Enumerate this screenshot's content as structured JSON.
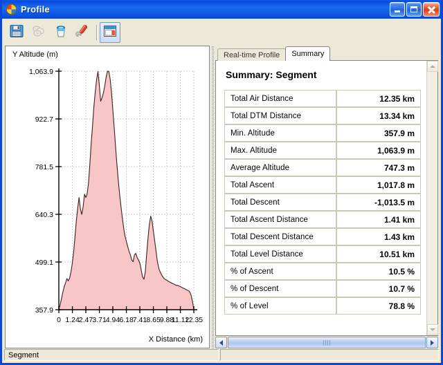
{
  "window": {
    "title": "Profile",
    "icon": "profile-globe-icon",
    "buttons": {
      "minimize": "Minimize",
      "maximize": "Maximize",
      "close": "Close"
    }
  },
  "toolbar": {
    "items": [
      {
        "name": "save-icon",
        "title": "Save",
        "enabled": true
      },
      {
        "name": "copy-icon",
        "title": "Copy",
        "enabled": false
      },
      {
        "name": "bucket-icon",
        "title": "Fill",
        "enabled": true
      },
      {
        "name": "settings-icon",
        "title": "Settings",
        "enabled": true
      },
      {
        "name": "layout-icon",
        "title": "Layout",
        "enabled": true,
        "selected": true
      }
    ]
  },
  "chart_data": {
    "type": "area",
    "title": "",
    "xlabel": "X Distance (km)",
    "ylabel": "Y Altitude (m)",
    "ylim": [
      357.9,
      1063.9
    ],
    "xlim": [
      0,
      12.35
    ],
    "grid": true,
    "legend": "none",
    "fill_color": "#f8c6c6",
    "line_color": "#3b2020",
    "yticks": [
      "1,063.9",
      "922.7",
      "781.5",
      "640.3",
      "499.1",
      "357.9"
    ],
    "ytick_values": [
      1063.9,
      922.7,
      781.5,
      640.3,
      499.1,
      357.9
    ],
    "xticks": [
      "0",
      "1.24",
      "2.47",
      "3.71",
      "4.94",
      "6.18",
      "7.41",
      "8.65",
      "9.88",
      "11.12",
      "12.35"
    ],
    "xtick_values": [
      0,
      1.24,
      2.47,
      3.71,
      4.94,
      6.18,
      7.41,
      8.65,
      9.88,
      11.12,
      12.35
    ],
    "x": [
      0.0,
      0.12,
      0.25,
      0.37,
      0.49,
      0.62,
      0.74,
      0.86,
      0.99,
      1.11,
      1.23,
      1.36,
      1.48,
      1.6,
      1.73,
      1.85,
      1.98,
      2.1,
      2.22,
      2.35,
      2.47,
      2.59,
      2.72,
      2.84,
      2.96,
      3.09,
      3.21,
      3.34,
      3.46,
      3.58,
      3.71,
      3.83,
      3.95,
      4.08,
      4.2,
      4.32,
      4.45,
      4.57,
      4.7,
      4.82,
      4.94,
      5.07,
      5.19,
      5.31,
      5.44,
      5.56,
      5.68,
      5.81,
      5.93,
      6.06,
      6.18,
      6.3,
      6.43,
      6.55,
      6.67,
      6.8,
      6.92,
      7.04,
      7.17,
      7.29,
      7.42,
      7.54,
      7.66,
      7.79,
      7.91,
      8.03,
      8.16,
      8.28,
      8.41,
      8.53,
      8.65,
      8.78,
      8.9,
      9.02,
      9.15,
      9.27,
      9.39,
      9.52,
      9.64,
      9.77,
      9.89,
      10.01,
      10.14,
      10.26,
      10.38,
      10.51,
      10.63,
      10.75,
      10.88,
      11.0,
      11.13,
      11.25,
      11.37,
      11.5,
      11.62,
      11.74,
      11.87,
      11.99,
      12.11,
      12.24,
      12.35
    ],
    "y": [
      357.9,
      372,
      392,
      410,
      426,
      438,
      450,
      443,
      452,
      470,
      495,
      530,
      575,
      620,
      660,
      690,
      655,
      640,
      662,
      700,
      690,
      700,
      735,
      790,
      850,
      905,
      960,
      1005,
      1040,
      1063,
      1020,
      975,
      985,
      1000,
      1020,
      1045,
      1064,
      1063,
      1040,
      1000,
      950,
      895,
      840,
      790,
      740,
      700,
      665,
      630,
      600,
      575,
      560,
      545,
      530,
      520,
      505,
      500,
      520,
      525,
      512,
      505,
      495,
      475,
      455,
      448,
      470,
      520,
      570,
      610,
      635,
      620,
      590,
      560,
      530,
      500,
      480,
      470,
      462,
      455,
      450,
      447,
      445,
      442,
      440,
      438,
      436,
      434,
      432,
      430,
      430,
      428,
      426,
      424,
      422,
      420,
      418,
      416,
      414,
      410,
      400,
      380,
      357.9
    ]
  },
  "tabs": [
    {
      "label": "Real-time Profile",
      "active": false
    },
    {
      "label": "Summary",
      "active": true
    }
  ],
  "summary": {
    "heading": "Summary: Segment",
    "rows": [
      {
        "label": "Total Air Distance",
        "value": "12.35 km"
      },
      {
        "label": "Total DTM Distance",
        "value": "13.34 km"
      },
      {
        "label": "Min. Altitude",
        "value": "357.9 m"
      },
      {
        "label": "Max. Altitude",
        "value": "1,063.9 m"
      },
      {
        "label": "Average Altitude",
        "value": "747.3 m"
      },
      {
        "label": "Total Ascent",
        "value": "1,017.8 m"
      },
      {
        "label": "Total Descent",
        "value": "-1,013.5 m"
      },
      {
        "label": "Total Ascent Distance",
        "value": "1.41 km"
      },
      {
        "label": "Total Descent Distance",
        "value": "1.43 km"
      },
      {
        "label": "Total Level Distance",
        "value": "10.51 km"
      },
      {
        "label": "% of Ascent",
        "value": "10.5 %"
      },
      {
        "label": "% of Descent",
        "value": "10.7 %"
      },
      {
        "label": "% of Level",
        "value": "78.8 %"
      }
    ]
  },
  "scrollbars": {
    "vertical": {
      "up": "scroll-up-arrow-icon",
      "down": "scroll-down-arrow-icon"
    },
    "horizontal": {
      "left": "scroll-left-arrow-icon",
      "right": "scroll-right-arrow-icon"
    }
  },
  "statusbar": {
    "panel1": "Segment",
    "panel2": ""
  }
}
